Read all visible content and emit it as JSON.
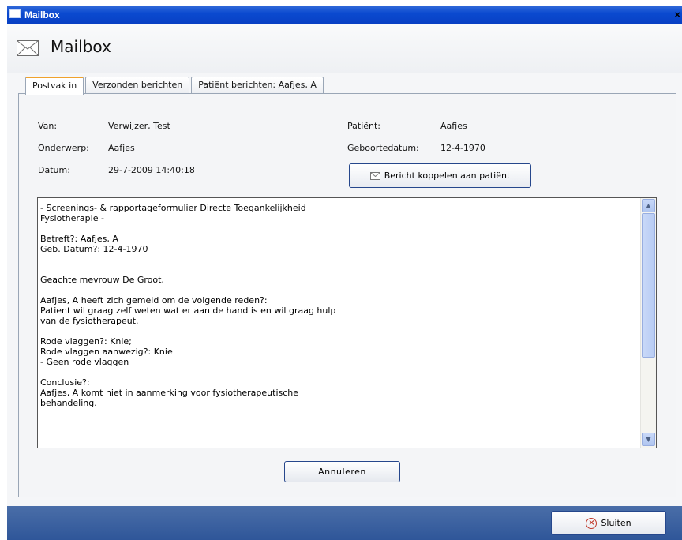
{
  "window": {
    "title": "Mailbox",
    "close_glyph": "×"
  },
  "header": {
    "title": "Mailbox",
    "icon": "envelope-icon"
  },
  "tabs": [
    {
      "label": "Postvak in",
      "active": true
    },
    {
      "label": "Verzonden berichten",
      "active": false
    },
    {
      "label": "Patiënt berichten: Aafjes, A",
      "active": false
    }
  ],
  "message": {
    "from_label": "Van:",
    "from_value": "Verwijzer, Test",
    "subject_label": "Onderwerp:",
    "subject_value": "Aafjes",
    "date_label": "Datum:",
    "date_value": "29-7-2009 14:40:18",
    "patient_label": "Patiënt:",
    "patient_value": "Aafjes",
    "dob_label": "Geboortedatum:",
    "dob_value": "12-4-1970",
    "link_button_label": "Bericht koppelen aan patiënt",
    "body": "- Screenings- & rapportageformulier Directe Toegankelijkheid\nFysiotherapie -\n\nBetreft?: Aafjes, A\nGeb. Datum?: 12-4-1970\n\n\nGeachte mevrouw De Groot,\n\nAafjes, A heeft zich gemeld om de volgende reden?:\nPatient wil graag zelf weten wat er aan de hand is en wil graag hulp\nvan de fysiotherapeut.\n\nRode vlaggen?: Knie;\nRode vlaggen aanwezig?: Knie\n- Geen rode vlaggen\n\nConclusie?:\nAafjes, A komt niet in aanmerking voor fysiotherapeutische\nbehandeling."
  },
  "buttons": {
    "cancel_label": "Annuleren",
    "close_label": "Sluiten"
  },
  "colors": {
    "titlebar": "#0a4ad0",
    "active_tab_accent": "#f0a22c",
    "bottom_bar": "#3a5f9e",
    "button_border": "#26478c"
  }
}
